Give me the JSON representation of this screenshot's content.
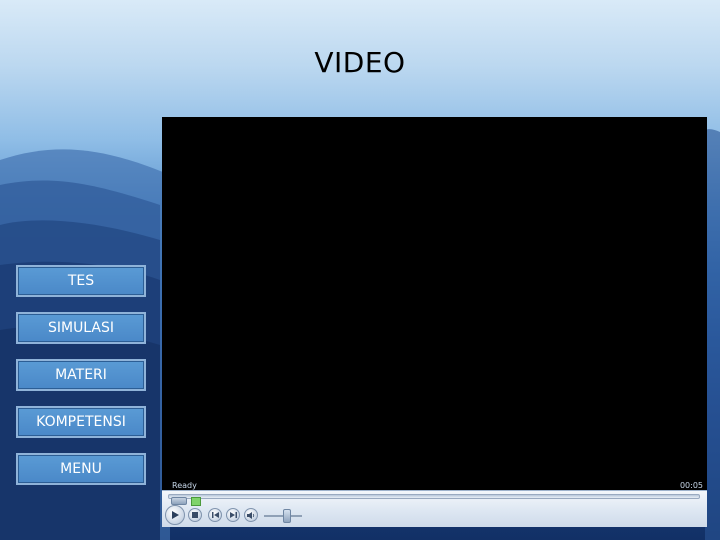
{
  "slide": {
    "title": "VIDEO"
  },
  "nav": {
    "items": [
      {
        "label": "TES"
      },
      {
        "label": "SIMULASI"
      },
      {
        "label": "MATERI"
      },
      {
        "label": "KOMPETENSI"
      },
      {
        "label": "MENU"
      }
    ]
  },
  "player": {
    "status": "Ready",
    "time": "00:05",
    "seek_position": 0,
    "volume_level": 0.5,
    "icons": {
      "play": "play-icon",
      "stop": "stop-icon",
      "previous": "previous-icon",
      "next": "next-icon",
      "mute": "speaker-icon"
    }
  },
  "colors": {
    "button_fill": "#4a88c8",
    "button_border": "#8fb3d9",
    "screen": "#000000"
  }
}
